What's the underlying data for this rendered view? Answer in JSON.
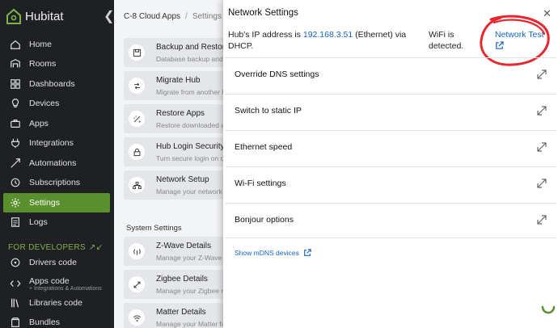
{
  "sidebar": {
    "brand": "Hubitat",
    "collapse_icon": "chevron-left-icon",
    "items": [
      {
        "label": "Home",
        "icon": "home-icon"
      },
      {
        "label": "Rooms",
        "icon": "rooms-icon"
      },
      {
        "label": "Dashboards",
        "icon": "dashboards-icon"
      },
      {
        "label": "Devices",
        "icon": "bulb-icon"
      },
      {
        "label": "Apps",
        "icon": "apps-icon"
      },
      {
        "label": "Integrations",
        "icon": "plug-icon"
      },
      {
        "label": "Automations",
        "icon": "automation-icon"
      },
      {
        "label": "Subscriptions",
        "icon": "subscriptions-icon"
      },
      {
        "label": "Settings",
        "icon": "gear-icon",
        "active": true
      },
      {
        "label": "Logs",
        "icon": "logs-icon"
      }
    ],
    "developers_header": "FOR DEVELOPERS",
    "dev_items": [
      {
        "label": "Drivers code",
        "icon": "drivers-icon"
      },
      {
        "label": "Apps code",
        "sub": "+ Integrations & Automations",
        "icon": "code-icon"
      },
      {
        "label": "Libraries code",
        "icon": "libraries-icon"
      },
      {
        "label": "Bundles",
        "icon": "bundles-icon"
      }
    ],
    "active_color": "#5a8f2e"
  },
  "page": {
    "breadcrumb": {
      "hub": "C-8 Cloud Apps",
      "current": "Settings"
    },
    "cards": [
      {
        "title": "Backup and Restore",
        "subtitle": "Database backup and restore",
        "icon": "backup-icon"
      },
      {
        "title": "Migrate Hub",
        "subtitle": "Migrate from another hub",
        "icon": "migrate-icon"
      },
      {
        "title": "Restore Apps",
        "subtitle": "Restore downloaded apps",
        "icon": "restore-icon"
      },
      {
        "title": "Hub Login Security",
        "subtitle": "Turn secure login on or off",
        "icon": "lock-icon"
      },
      {
        "title": "Network Setup",
        "subtitle": "Manage your network settings",
        "icon": "network-icon"
      }
    ],
    "system_section": "System Settings",
    "system_cards": [
      {
        "title": "Z-Wave Details",
        "subtitle": "Manage your Z-Wave mesh",
        "icon": "zwave-icon"
      },
      {
        "title": "Zigbee Details",
        "subtitle": "Manage your Zigbee mesh",
        "icon": "zigbee-icon"
      },
      {
        "title": "Matter Details",
        "subtitle": "Manage your Matter fabric",
        "icon": "matter-icon"
      }
    ]
  },
  "dialog": {
    "title": "Network Settings",
    "close_icon": "close-icon",
    "ip_prefix": "Hub's IP address is ",
    "ip": "192.168.3.51",
    "ip_suffix": " (Ethernet) via DHCP.",
    "wifi_status": "WiFi is detected.",
    "network_test": "Network Test",
    "rows": [
      {
        "label": "Override DNS settings"
      },
      {
        "label": "Switch to static IP"
      },
      {
        "label": "Ethernet speed"
      },
      {
        "label": "Wi-Fi settings"
      },
      {
        "label": "Bonjour options"
      }
    ],
    "mdns_link": "Show mDNS devices",
    "annotation_color": "#e8262e",
    "link_color": "#1565c0"
  }
}
